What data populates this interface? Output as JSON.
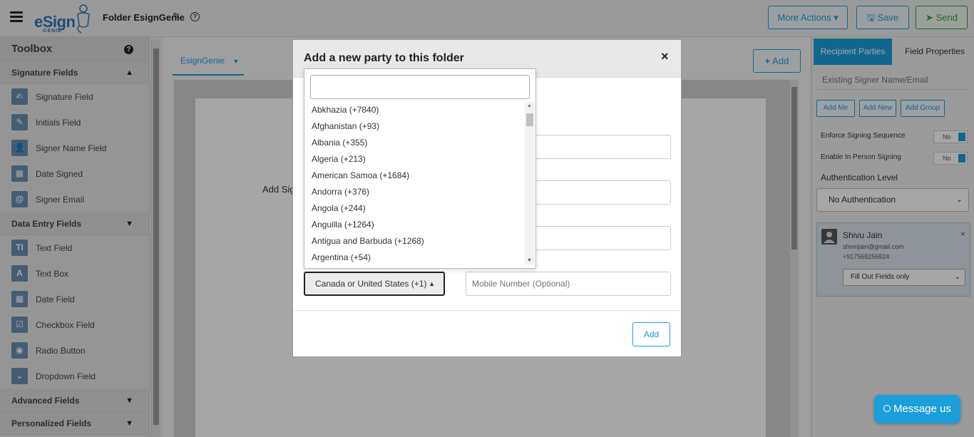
{
  "header": {
    "logo_text": "eSign",
    "logo_sub": "GENIE",
    "folder_title": "Folder EsignGenie",
    "help_symbol": "?",
    "more_actions": "More Actions ▾",
    "save": "Save",
    "send": "Send"
  },
  "toolbox": {
    "title": "Toolbox",
    "sections": [
      {
        "label": "Signature Fields",
        "items": [
          "Signature Field",
          "Initials Field",
          "Signer Name Field",
          "Date Signed",
          "Signer Email"
        ]
      },
      {
        "label": "Data Entry Fields",
        "items": [
          "Text Field",
          "Text Box",
          "Date Field",
          "Checkbox Field",
          "Radio Button",
          "Dropdown Field"
        ]
      },
      {
        "label": "Advanced Fields"
      },
      {
        "label": "Personalized Fields"
      }
    ],
    "icon_glyphs": [
      "✍",
      "✎",
      "👤",
      "▦",
      "@",
      "TI",
      "A",
      "▦",
      "☑",
      "◉",
      "⌄"
    ]
  },
  "document": {
    "tab_label": "EsignGenie",
    "add_button": "Add",
    "page_text": "Add Sig"
  },
  "right_panel": {
    "tabs": [
      "Recipient Parties",
      "Field Properties"
    ],
    "search_placeholder": "Existing Signer Name/Email",
    "buttons": [
      "Add Me",
      "Add New",
      "Add Group"
    ],
    "enforce_label": "Enforce Signing Sequence",
    "enforce_value": "No",
    "in_person_label": "Enable In Person Signing",
    "in_person_value": "No",
    "auth_label": "Authentication Level",
    "auth_value": "No Authentication",
    "recipient": {
      "name": "Shivu Jain",
      "email": "shvmjain@gmail.com",
      "phone": "+917568256824",
      "role": "Fill Out Fields only"
    }
  },
  "modal": {
    "title": "Add a new party to this folder",
    "close_symbol": "×",
    "country_selected": "Canada or United States (+1)",
    "mobile_placeholder": "Mobile Number (Optional)",
    "add_button": "Add"
  },
  "country_dropdown": {
    "options": [
      "Abkhazia (+7840)",
      "Afghanistan (+93)",
      "Albania (+355)",
      "Algeria (+213)",
      "American Samoa (+1684)",
      "Andorra (+376)",
      "Angola (+244)",
      "Anguilla (+1264)",
      "Antigua and Barbuda (+1268)",
      "Argentina (+54)"
    ]
  },
  "chat": {
    "label": "Message us"
  },
  "colors": {
    "accent": "#1b9ed9",
    "send_green": "#2aa34a",
    "logo_blue": "#2e79b5"
  }
}
